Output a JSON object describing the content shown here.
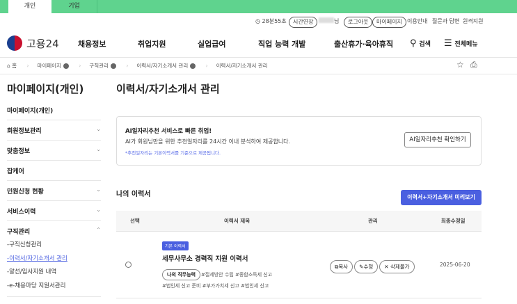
{
  "top_tabs": [
    "개인",
    "기업"
  ],
  "util": {
    "timer": "28분55초",
    "extend": "시간연장",
    "user_suffix": "님",
    "logout": "로그아웃",
    "mypage": "마이페이지",
    "guide": "이용안내",
    "qna": "질문과 답변",
    "remote": "원격지원"
  },
  "logo": "고용24",
  "gnb": [
    "채용정보",
    "취업지원",
    "실업급여",
    "직업 능력 개발",
    "출산휴가·육아휴직"
  ],
  "search": "검색",
  "allmenu": "전체메뉴",
  "breadcrumb": [
    "홈",
    "마이페이지",
    "구직관리",
    "이력서/자기소개서 관리",
    "이력서/자기소개서 관리"
  ],
  "sidebar": {
    "title": "마이페이지(개인)",
    "items": [
      "마이페이지(개인)",
      "회원정보관리",
      "맞춤정보",
      "잡케어",
      "민원신청 현황",
      "서비스이력",
      "구직관리"
    ],
    "sub": [
      "-구직신청관리",
      "-이력서/자기소개서 관리",
      "-알선/입사지원 내역",
      "-e-채용마당 지원서관리"
    ]
  },
  "page_title": "이력서/자기소개서 관리",
  "ai_box": {
    "title": "AI일자리추천 서비스로 빠른 취업!",
    "desc": "AI가 회원님만을 위한 추천일자리를 24시간 이내 분석하여 제공합니다.",
    "note": "*추천일자리는 기본이력서를 기준으로 제공됩니다.",
    "button": "AI일자리추천 확인하기"
  },
  "resume_section": {
    "title": "나의 이력서",
    "preview_button": "이력서+자기소개서 미리보기"
  },
  "table": {
    "headers": [
      "선택",
      "이력서 제목",
      "관리",
      "최종수정일"
    ],
    "rows": [
      {
        "badge": "기본 이력서",
        "title": "세무사무소 경력직 지원 이력서",
        "skill": "나의 직무능력",
        "tags1": "#절세방안 수립 #종합소득세 신고",
        "tags2": "#법인세 신고 준비 #부가가치세 신고 #법인세 신고",
        "copy": "복사",
        "edit": "수정",
        "delete": "삭제불가",
        "date": "2025-06-20"
      }
    ]
  },
  "colors": {
    "green": "#5fd38e",
    "primary": "#4a5fe0"
  }
}
